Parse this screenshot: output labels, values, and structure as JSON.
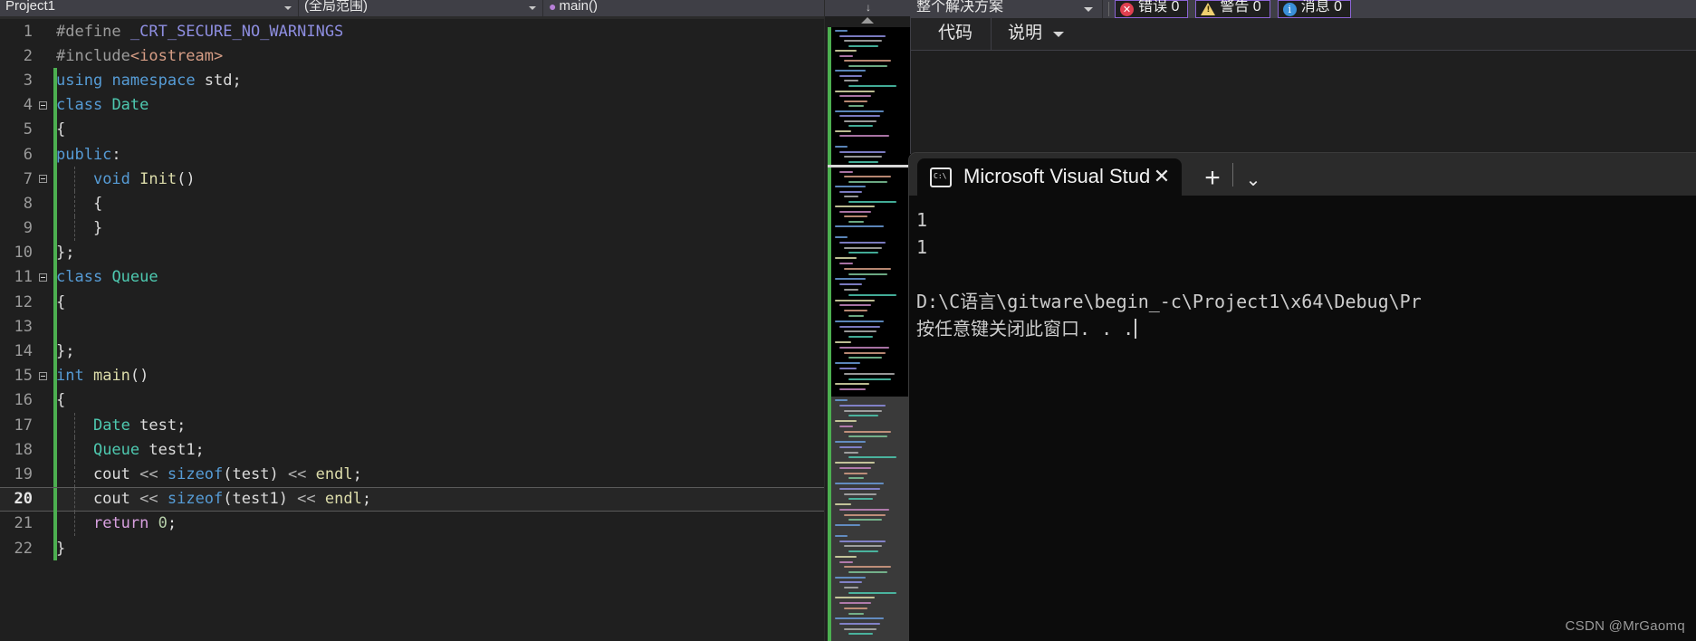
{
  "editor": {
    "nav": {
      "project_combo": "Project1",
      "scope_combo": "(全局范围)",
      "member_combo": "main()",
      "member_icon": "method-icon",
      "dropdown_icon": "chevron-down-icon"
    },
    "lines": [
      {
        "n": "1",
        "changed": false,
        "fold": false,
        "indent": 0,
        "tokens": [
          {
            "t": "#define ",
            "c": "t-pre"
          },
          {
            "t": "_CRT_SECURE_NO_WARNINGS",
            "c": "t-macro"
          }
        ]
      },
      {
        "n": "2",
        "changed": false,
        "fold": false,
        "indent": 0,
        "tokens": [
          {
            "t": "#include",
            "c": "t-pre"
          },
          {
            "t": "<iostream>",
            "c": "t-str"
          }
        ]
      },
      {
        "n": "3",
        "changed": true,
        "fold": false,
        "indent": 0,
        "tokens": [
          {
            "t": "using",
            "c": "t-kw"
          },
          {
            "t": " ",
            "c": "t-plain"
          },
          {
            "t": "namespace",
            "c": "t-kw"
          },
          {
            "t": " std;",
            "c": "t-plain"
          }
        ]
      },
      {
        "n": "4",
        "changed": true,
        "fold": true,
        "indent": 0,
        "tokens": [
          {
            "t": "class",
            "c": "t-kw"
          },
          {
            "t": " ",
            "c": "t-plain"
          },
          {
            "t": "Date",
            "c": "t-type"
          }
        ]
      },
      {
        "n": "5",
        "changed": true,
        "fold": false,
        "indent": 0,
        "tokens": [
          {
            "t": "{",
            "c": "t-punc"
          }
        ]
      },
      {
        "n": "6",
        "changed": true,
        "fold": false,
        "indent": 0,
        "tokens": [
          {
            "t": "public",
            "c": "t-kw"
          },
          {
            "t": ":",
            "c": "t-punc"
          }
        ]
      },
      {
        "n": "7",
        "changed": true,
        "fold": true,
        "indent": 1,
        "tokens": [
          {
            "t": "    ",
            "c": "t-plain"
          },
          {
            "t": "void",
            "c": "t-kw"
          },
          {
            "t": " ",
            "c": "t-plain"
          },
          {
            "t": "Init",
            "c": "t-fn"
          },
          {
            "t": "()",
            "c": "t-punc"
          }
        ]
      },
      {
        "n": "8",
        "changed": true,
        "fold": false,
        "indent": 1,
        "tokens": [
          {
            "t": "    {",
            "c": "t-punc"
          }
        ]
      },
      {
        "n": "9",
        "changed": true,
        "fold": false,
        "indent": 1,
        "tokens": [
          {
            "t": "    }",
            "c": "t-punc"
          }
        ]
      },
      {
        "n": "10",
        "changed": true,
        "fold": false,
        "indent": 0,
        "tokens": [
          {
            "t": "};",
            "c": "t-punc"
          }
        ]
      },
      {
        "n": "11",
        "changed": true,
        "fold": true,
        "indent": 0,
        "tokens": [
          {
            "t": "class",
            "c": "t-kw"
          },
          {
            "t": " ",
            "c": "t-plain"
          },
          {
            "t": "Queue",
            "c": "t-type"
          }
        ]
      },
      {
        "n": "12",
        "changed": true,
        "fold": false,
        "indent": 0,
        "tokens": [
          {
            "t": "{",
            "c": "t-punc"
          }
        ]
      },
      {
        "n": "13",
        "changed": true,
        "fold": false,
        "indent": 0,
        "tokens": [
          {
            "t": "",
            "c": "t-plain"
          }
        ]
      },
      {
        "n": "14",
        "changed": true,
        "fold": false,
        "indent": 0,
        "tokens": [
          {
            "t": "};",
            "c": "t-punc"
          }
        ]
      },
      {
        "n": "15",
        "changed": true,
        "fold": true,
        "indent": 0,
        "tokens": [
          {
            "t": "int",
            "c": "t-kw"
          },
          {
            "t": " ",
            "c": "t-plain"
          },
          {
            "t": "main",
            "c": "t-fn"
          },
          {
            "t": "()",
            "c": "t-punc"
          }
        ]
      },
      {
        "n": "16",
        "changed": true,
        "fold": false,
        "indent": 0,
        "tokens": [
          {
            "t": "{",
            "c": "t-punc"
          }
        ]
      },
      {
        "n": "17",
        "changed": true,
        "fold": false,
        "indent": 1,
        "tokens": [
          {
            "t": "    ",
            "c": "t-plain"
          },
          {
            "t": "Date",
            "c": "t-type"
          },
          {
            "t": " test;",
            "c": "t-plain"
          }
        ]
      },
      {
        "n": "18",
        "changed": true,
        "fold": false,
        "indent": 1,
        "tokens": [
          {
            "t": "    ",
            "c": "t-plain"
          },
          {
            "t": "Queue",
            "c": "t-type"
          },
          {
            "t": " test1;",
            "c": "t-plain"
          }
        ]
      },
      {
        "n": "19",
        "changed": true,
        "fold": false,
        "indent": 1,
        "tokens": [
          {
            "t": "    cout ",
            "c": "t-plain"
          },
          {
            "t": "<<",
            "c": "t-op"
          },
          {
            "t": " ",
            "c": "t-plain"
          },
          {
            "t": "sizeof",
            "c": "t-kw"
          },
          {
            "t": "(test) ",
            "c": "t-plain"
          },
          {
            "t": "<<",
            "c": "t-op"
          },
          {
            "t": " ",
            "c": "t-plain"
          },
          {
            "t": "endl",
            "c": "t-fn"
          },
          {
            "t": ";",
            "c": "t-punc"
          }
        ]
      },
      {
        "n": "20",
        "changed": true,
        "fold": false,
        "indent": 1,
        "current": true,
        "tokens": [
          {
            "t": "    cout ",
            "c": "t-plain"
          },
          {
            "t": "<<",
            "c": "t-op"
          },
          {
            "t": " ",
            "c": "t-plain"
          },
          {
            "t": "sizeof",
            "c": "t-kw"
          },
          {
            "t": "(test1) ",
            "c": "t-plain"
          },
          {
            "t": "<<",
            "c": "t-op"
          },
          {
            "t": " ",
            "c": "t-plain"
          },
          {
            "t": "endl",
            "c": "t-fn"
          },
          {
            "t": ";",
            "c": "t-punc"
          }
        ]
      },
      {
        "n": "21",
        "changed": true,
        "fold": false,
        "indent": 1,
        "tokens": [
          {
            "t": "    ",
            "c": "t-plain"
          },
          {
            "t": "return",
            "c": "t-ctrl"
          },
          {
            "t": " ",
            "c": "t-plain"
          },
          {
            "t": "0",
            "c": "t-num"
          },
          {
            "t": ";",
            "c": "t-punc"
          }
        ]
      },
      {
        "n": "22",
        "changed": true,
        "fold": false,
        "indent": 0,
        "tokens": [
          {
            "t": "}",
            "c": "t-punc"
          }
        ]
      }
    ]
  },
  "minimap": {
    "scroll_up_icon": "caret-up-icon",
    "scroll_down_icon": "caret-down-icon"
  },
  "error_list": {
    "scope_filter": "整个解决方案",
    "scope_filter_icon": "chevron-down-icon",
    "badges": [
      {
        "icon": "error-icon",
        "label": "错误 0"
      },
      {
        "icon": "warning-icon",
        "label": "警告 0"
      },
      {
        "icon": "info-icon",
        "label": "消息 0"
      }
    ],
    "columns": [
      {
        "label": "代码",
        "has_chevron": false
      },
      {
        "label": "说明",
        "has_chevron": true
      }
    ]
  },
  "terminal": {
    "tab_title": "Microsoft Visual Stud",
    "tab_icon": "console-icon",
    "close_icon": "close-icon",
    "new_tab_icon": "plus-icon",
    "dropdown_icon": "chevron-down-icon",
    "output": [
      "1",
      "1",
      "",
      "D:\\C语言\\gitware\\begin_-c\\Project1\\x64\\Debug\\Pr",
      "按任意键关闭此窗口. . ."
    ]
  },
  "watermark": "CSDN @MrGaomq"
}
